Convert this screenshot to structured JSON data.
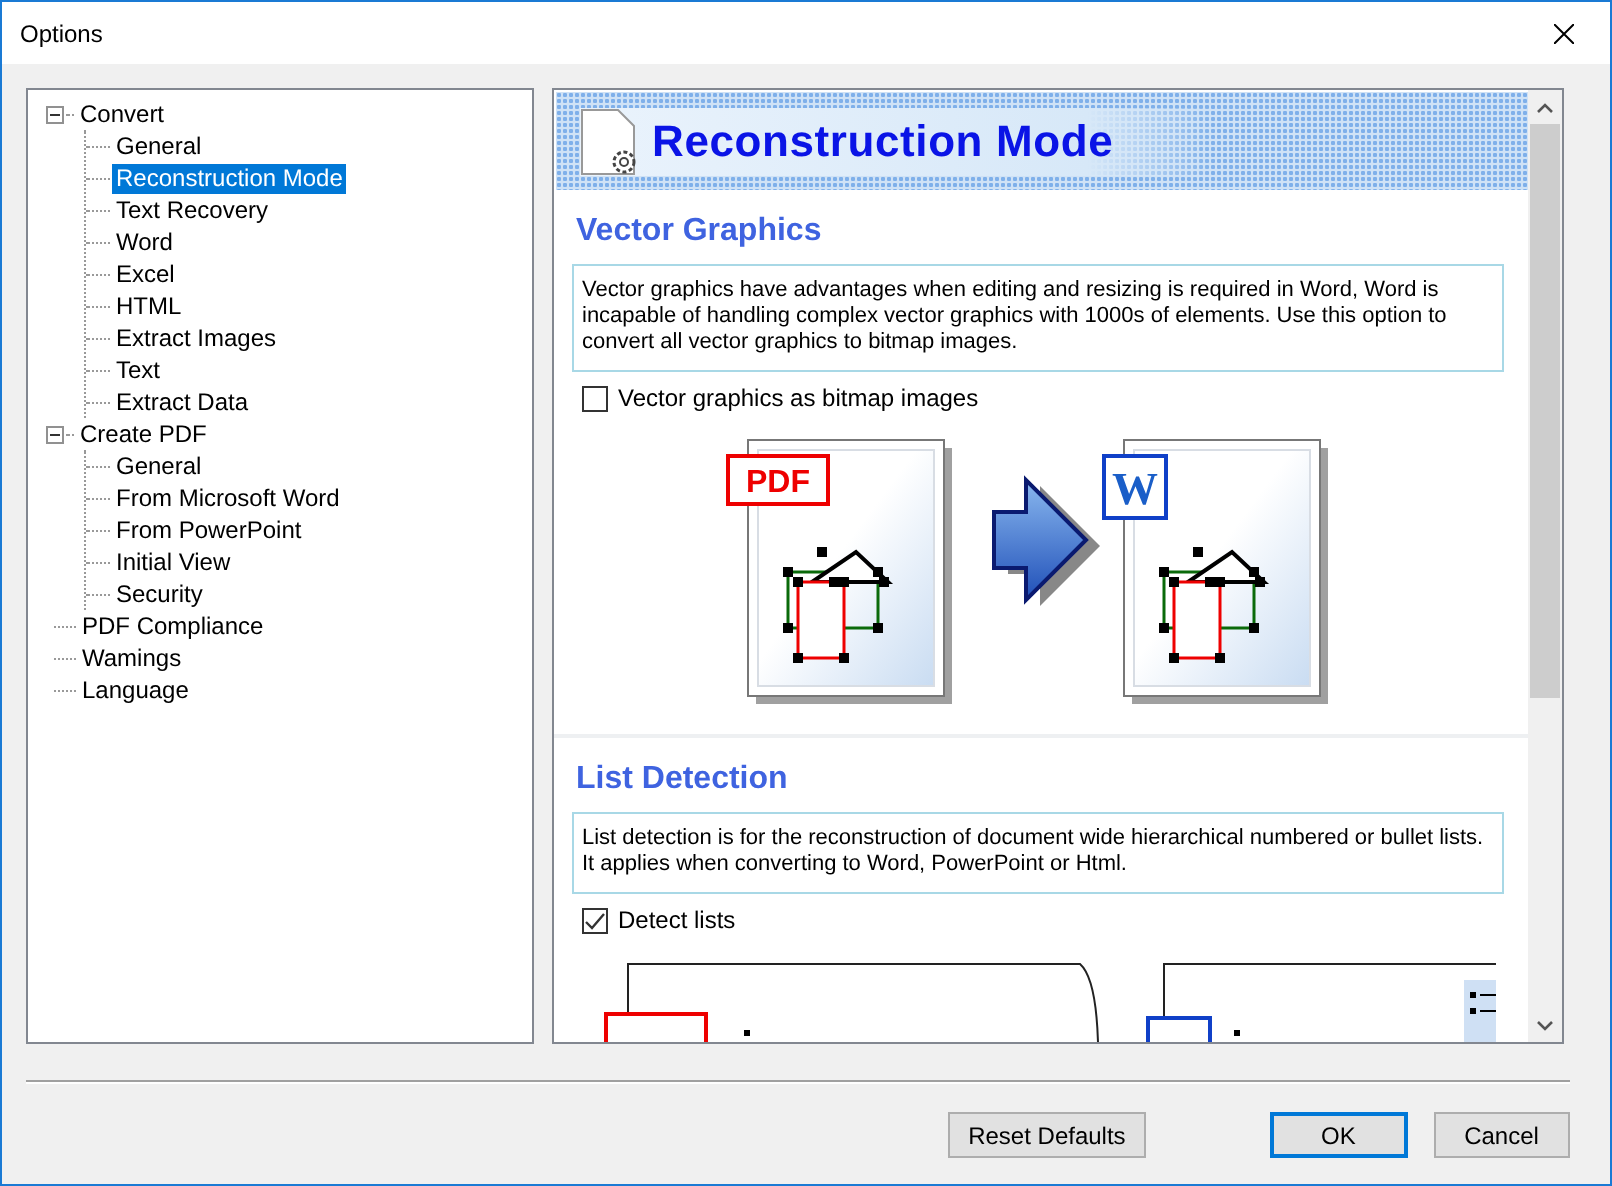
{
  "window": {
    "title": "Options"
  },
  "tree": [
    {
      "label": "Convert",
      "selected": false,
      "expanded": true,
      "children": [
        {
          "label": "General",
          "selected": false
        },
        {
          "label": "Reconstruction Mode",
          "selected": true
        },
        {
          "label": "Text Recovery",
          "selected": false
        },
        {
          "label": "Word",
          "selected": false
        },
        {
          "label": "Excel",
          "selected": false
        },
        {
          "label": "HTML",
          "selected": false
        },
        {
          "label": "Extract Images",
          "selected": false
        },
        {
          "label": "Text",
          "selected": false
        },
        {
          "label": "Extract Data",
          "selected": false
        }
      ]
    },
    {
      "label": "Create PDF",
      "selected": false,
      "expanded": true,
      "children": [
        {
          "label": "General",
          "selected": false
        },
        {
          "label": "From Microsoft Word",
          "selected": false
        },
        {
          "label": "From PowerPoint",
          "selected": false
        },
        {
          "label": "Initial View",
          "selected": false
        },
        {
          "label": "Security",
          "selected": false
        }
      ]
    },
    {
      "label": "PDF Compliance",
      "selected": false
    },
    {
      "label": "Wamings",
      "selected": false
    },
    {
      "label": "Language",
      "selected": false
    }
  ],
  "page": {
    "title": "Reconstruction Mode",
    "sections": [
      {
        "heading": "Vector Graphics",
        "description": "Vector graphics have advantages when editing and resizing is required in Word, Word is incapable of handling complex vector graphics with 1000s of elements. Use this option to convert all vector graphics to bitmap images.",
        "option": {
          "label": "Vector graphics as bitmap images",
          "checked": false
        },
        "illustration": {
          "kind": "conversion",
          "source_badge": "PDF",
          "target_badge": "W"
        }
      },
      {
        "heading": "List Detection",
        "description": "List detection is for the reconstruction of document wide hierarchical numbered or bullet lists. It applies when converting to Word, PowerPoint or Html.",
        "option": {
          "label": "Detect lists",
          "checked": true
        },
        "illustration": {
          "kind": "lists"
        }
      }
    ]
  },
  "buttons": [
    {
      "label": "Reset Defaults",
      "default": false
    },
    {
      "label": "OK",
      "default": true
    },
    {
      "label": "Cancel",
      "default": false
    }
  ]
}
